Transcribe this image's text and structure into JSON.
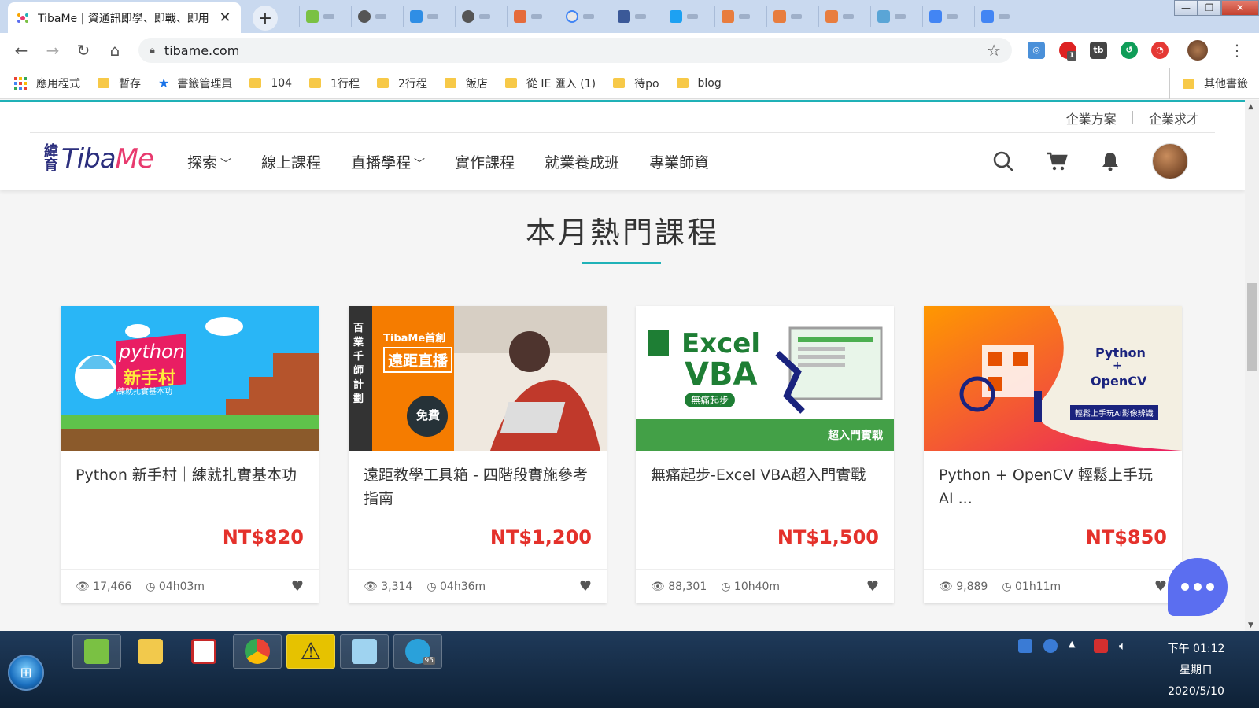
{
  "browser": {
    "active_tab_title": "TibaMe | 資通訊即學、即戰、即用",
    "new_tab_symbol": "+",
    "close_symbol": "✕",
    "url": "tibame.com",
    "bookmarks": [
      {
        "label": "應用程式",
        "type": "apps"
      },
      {
        "label": "暫存",
        "type": "folder"
      },
      {
        "label": "書籤管理員",
        "type": "star"
      },
      {
        "label": "104",
        "type": "folder"
      },
      {
        "label": "1行程",
        "type": "folder"
      },
      {
        "label": "2行程",
        "type": "folder"
      },
      {
        "label": "飯店",
        "type": "folder"
      },
      {
        "label": "從 IE 匯入 (1)",
        "type": "folder"
      },
      {
        "label": "待po",
        "type": "folder"
      },
      {
        "label": "blog",
        "type": "folder"
      }
    ],
    "other_bookmarks": "其他書籤",
    "extension_badge": "1"
  },
  "site": {
    "biz_links": [
      "企業方案",
      "企業求才"
    ],
    "logo_cn_top": "緯",
    "logo_cn_bottom": "育",
    "logo_en_a": "Tiba",
    "logo_en_b": "Me",
    "nav": [
      {
        "label": "探索",
        "caret": true
      },
      {
        "label": "線上課程",
        "caret": false
      },
      {
        "label": "直播學程",
        "caret": true
      },
      {
        "label": "實作課程",
        "caret": false
      },
      {
        "label": "就業養成班",
        "caret": false
      },
      {
        "label": "專業師資",
        "caret": false
      }
    ],
    "section_title": "本月熱門課程",
    "courses": [
      {
        "title": "Python 新手村｜練就扎實基本功",
        "price": "NT$820",
        "views": "17,466",
        "duration": "04h03m",
        "thumb": {
          "main": "python",
          "sub": "新手村",
          "tag": "練就扎實基本功"
        }
      },
      {
        "title": "遠距教學工具箱 - 四階段實施參考指南",
        "price": "NT$1,200",
        "views": "3,314",
        "duration": "04h36m",
        "thumb": {
          "side": "百業千師計劃",
          "badge": "TibaMe首創",
          "main": "遠距直播",
          "tag": "免費"
        }
      },
      {
        "title": "無痛起步-Excel VBA超入門實戰",
        "price": "NT$1,500",
        "views": "88,301",
        "duration": "10h40m",
        "thumb": {
          "main": "Excel",
          "sub": "VBA",
          "tag": "無痛起步",
          "corner": "超入門實戰"
        }
      },
      {
        "title": "Python + OpenCV 輕鬆上手玩 AI ...",
        "price": "NT$850",
        "views": "9,889",
        "duration": "01h11m",
        "thumb": {
          "main": "Python",
          "plus": "+",
          "sub": "OpenCV",
          "tag": "輕鬆上手玩AI影像辨識"
        }
      }
    ]
  },
  "taskbar": {
    "clock_time": "下午 01:12",
    "clock_day": "星期日",
    "clock_date": "2020/5/10",
    "telegram_badge": "95"
  },
  "colors": {
    "accent": "#20b2b8",
    "price": "#e4312b",
    "brand_blue": "#2b2e7d",
    "brand_pink": "#e83a6e",
    "chat": "#5b6ef0"
  }
}
